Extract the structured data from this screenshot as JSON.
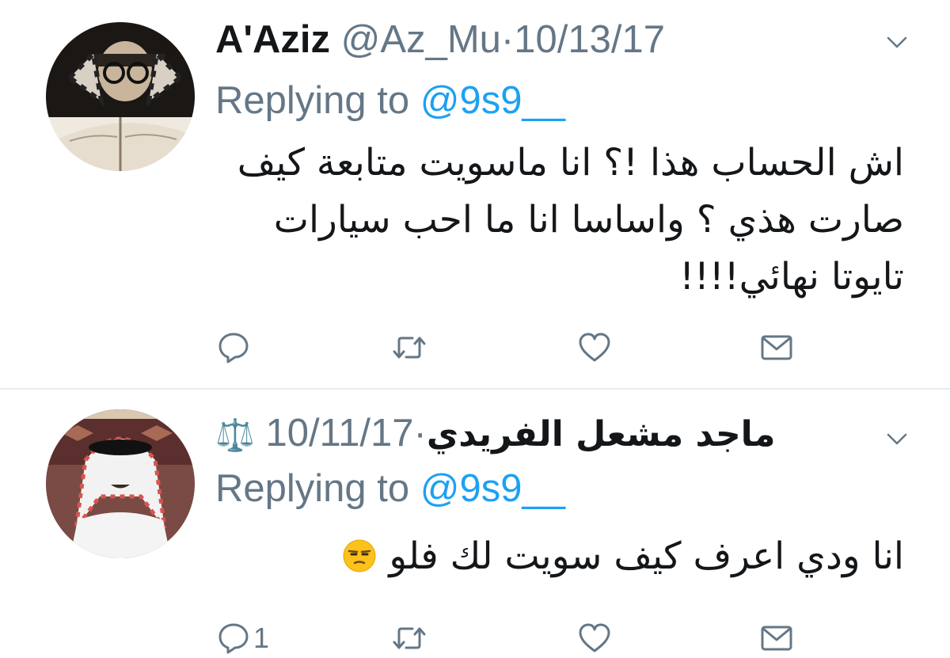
{
  "tweets": [
    {
      "name": "A'Aziz",
      "handle": "@Az_Mu",
      "separator": "·",
      "date": "10/13/17",
      "replying_label": "Replying to",
      "replying_to": "@9s9__",
      "body_lines": [
        "اش الحساب هذا !؟ انا ماسويت متابعة كيف",
        "صارت هذي ؟ واساسا انا ما احب سيارات",
        "تايوتا نهائي!!!!"
      ],
      "actions": {
        "reply_count": ""
      }
    },
    {
      "name": "ماجد مشعل الفريدي",
      "name_emoji": "⚖️",
      "separator": "·",
      "date": "10/11/17",
      "replying_label": "Replying to",
      "replying_to": "@9s9__",
      "body_lines": [
        "انا ودي اعرف كيف سويت لك فلو"
      ],
      "body_emoji": "😒",
      "actions": {
        "reply_count": "1"
      }
    }
  ],
  "icons": [
    "reply-icon",
    "retweet-icon",
    "like-icon",
    "direct-message-icon",
    "chevron-down-icon"
  ],
  "colors": {
    "text": "#14171a",
    "secondary": "#657786",
    "link": "#1da1f2",
    "icon": "#657786",
    "divider": "#e6ecf0"
  }
}
